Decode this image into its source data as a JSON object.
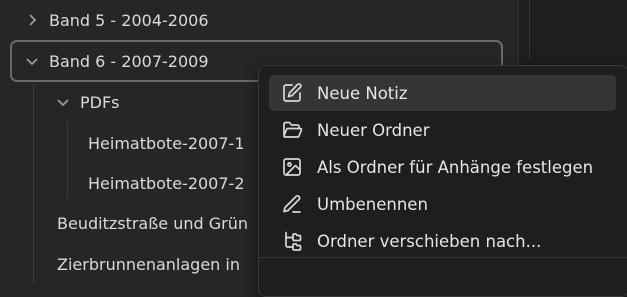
{
  "explorer": {
    "items": [
      {
        "label": "Band 5 - 2004-2006",
        "expanded": false
      },
      {
        "label": "Band 6 - 2007-2009",
        "expanded": true,
        "selected": true
      },
      {
        "label": "PDFs",
        "expanded": true
      },
      {
        "label": "Heimatbote-2007-1"
      },
      {
        "label": "Heimatbote-2007-2"
      },
      {
        "label": "Beuditzstraße und Grün"
      },
      {
        "label": "Zierbrunnenanlagen in"
      }
    ]
  },
  "context_menu": {
    "items": [
      {
        "label": "Neue Notiz",
        "icon": "edit-note-icon",
        "hovered": true
      },
      {
        "label": "Neuer Ordner",
        "icon": "folder-open-icon"
      },
      {
        "label": "Als Ordner für Anhänge festlegen",
        "icon": "image-icon"
      },
      {
        "label": "Umbenennen",
        "icon": "pencil-icon"
      },
      {
        "label": "Ordner verschieben nach...",
        "icon": "folder-tree-icon"
      }
    ]
  },
  "colors": {
    "background": "#262626",
    "menu_background": "#1e1e1e",
    "hover": "#353535",
    "text": "#dadada",
    "selected_border": "#6a6a6a"
  }
}
